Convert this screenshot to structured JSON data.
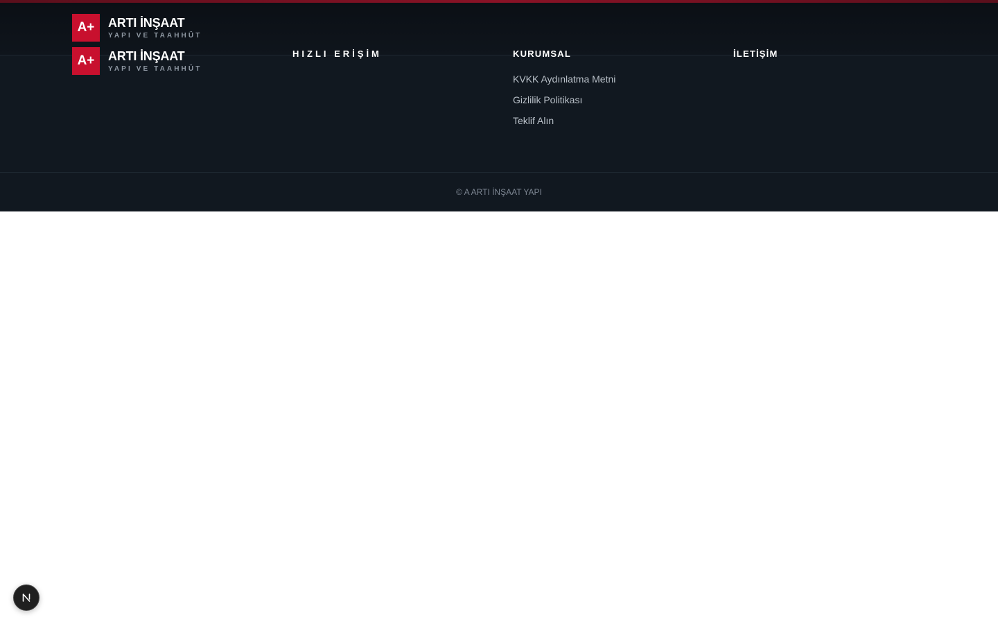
{
  "brand": {
    "mark": "A+",
    "name": "ARTI İNŞAAT",
    "tagline": "YAPI VE TAAHHÜT"
  },
  "footer": {
    "columns": {
      "quick_access": {
        "title": "HIZLI ERİŞİM"
      },
      "corporate": {
        "title": "KURUMSAL",
        "links": [
          "KVKK Aydınlatma Metni",
          "Gizlilik Politikası",
          "Teklif Alın"
        ]
      },
      "contact": {
        "title": "İLETİŞİM"
      }
    },
    "copyright": "© A ARTI İNŞAAT YAPI"
  },
  "dev_badge": {
    "icon": "nextjs-n-icon",
    "letter": "N"
  },
  "colors": {
    "brand_red": "#c8102e",
    "footer_bg": "#111820",
    "top_accent": "#8a1226"
  }
}
